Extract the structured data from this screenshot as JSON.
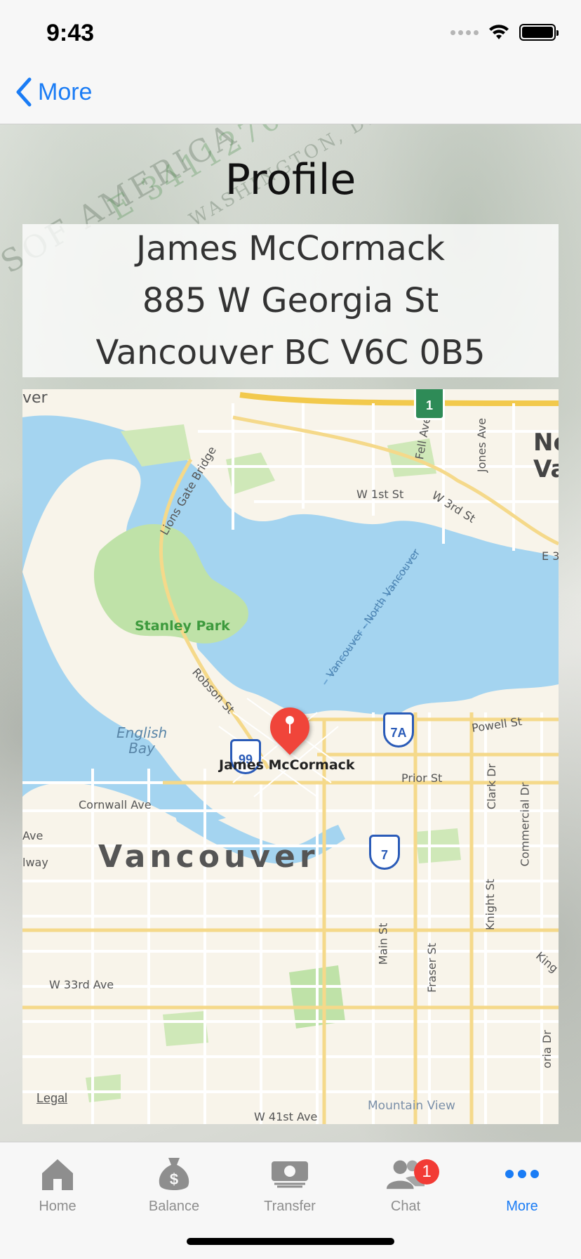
{
  "status_bar": {
    "time": "9:43"
  },
  "nav": {
    "back_label": "More"
  },
  "page": {
    "title": "Profile",
    "name": "James McCormack",
    "address_line1": "885 W Georgia St",
    "address_line2": "Vancouver BC V6C 0B5"
  },
  "map": {
    "pin_label": "James McCormack",
    "legal": "Legal",
    "labels": {
      "stanley_park": "Stanley Park",
      "english_bay": "English\nBay",
      "vancouver": "Vancouver",
      "lions_gate": "Lions Gate Bridge",
      "robson": "Robson St",
      "cornwall": "Cornwall Ave",
      "w33rd": "W 33rd Ave",
      "prior": "Prior St",
      "powell": "Powell St",
      "w1st": "W 1st St",
      "w3rd": "W 3rd St",
      "fell": "Fell Ave",
      "jones": "Jones Ave",
      "main": "Main St",
      "fraser": "Fraser St",
      "knight": "Knight St",
      "clark": "Clark Dr",
      "commercial": "Commercial Dr",
      "ferry": "Vancouver - North Vancouver",
      "mountain_view": "Mountain View",
      "nv": "No",
      "va": "Va",
      "ave": "Ave",
      "lway": "lway",
      "ver": "ver",
      "e3": "E 3",
      "kin": "King",
      "oria": "oria Dr",
      "w41st": "W 41st Ave"
    },
    "shields": {
      "h99": "99",
      "h7a": "7A",
      "h7": "7",
      "h1": "1"
    }
  },
  "tab_bar": {
    "items": [
      {
        "label": "Home",
        "icon": "home-icon"
      },
      {
        "label": "Balance",
        "icon": "money-bag-icon"
      },
      {
        "label": "Transfer",
        "icon": "banknote-icon"
      },
      {
        "label": "Chat",
        "icon": "people-icon",
        "badge": "1"
      },
      {
        "label": "More",
        "icon": "ellipsis-icon",
        "active": true
      }
    ]
  },
  "colors": {
    "accent": "#1a7cf5",
    "badge": "#f23b35",
    "water": "#a4d4f0",
    "park": "#bfe2a8",
    "pin": "#f0453a"
  }
}
